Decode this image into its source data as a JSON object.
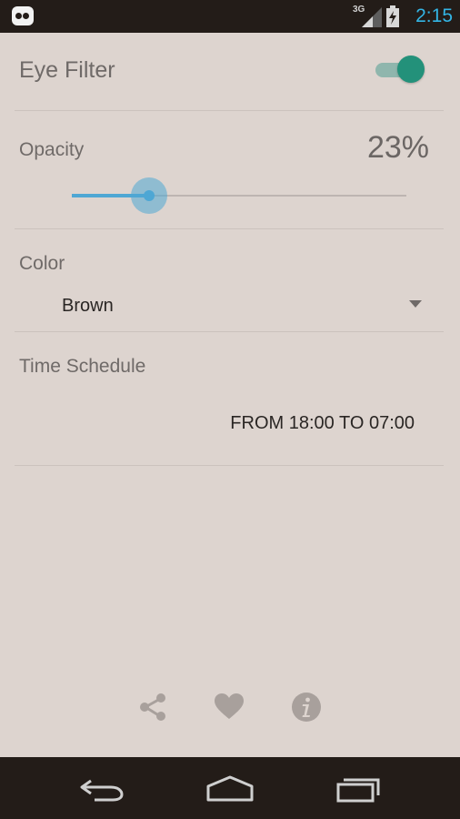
{
  "status_bar": {
    "network": "3G",
    "time": "2:15",
    "accent_color": "#33b5e5"
  },
  "eye_filter": {
    "title": "Eye Filter",
    "enabled": true,
    "toggle_color": "#23917a"
  },
  "opacity": {
    "label": "Opacity",
    "value_text": "23%",
    "value": 0.23,
    "slider_color": "#4ea7d4"
  },
  "color": {
    "label": "Color",
    "selected": "Brown"
  },
  "schedule": {
    "label": "Time Schedule",
    "text": "FROM 18:00 TO 07:00"
  },
  "actions": {
    "icons": [
      "share-icon",
      "heart-icon",
      "info-icon"
    ]
  },
  "nav": {
    "icons": [
      "back-icon",
      "home-icon",
      "recent-apps-icon"
    ]
  }
}
